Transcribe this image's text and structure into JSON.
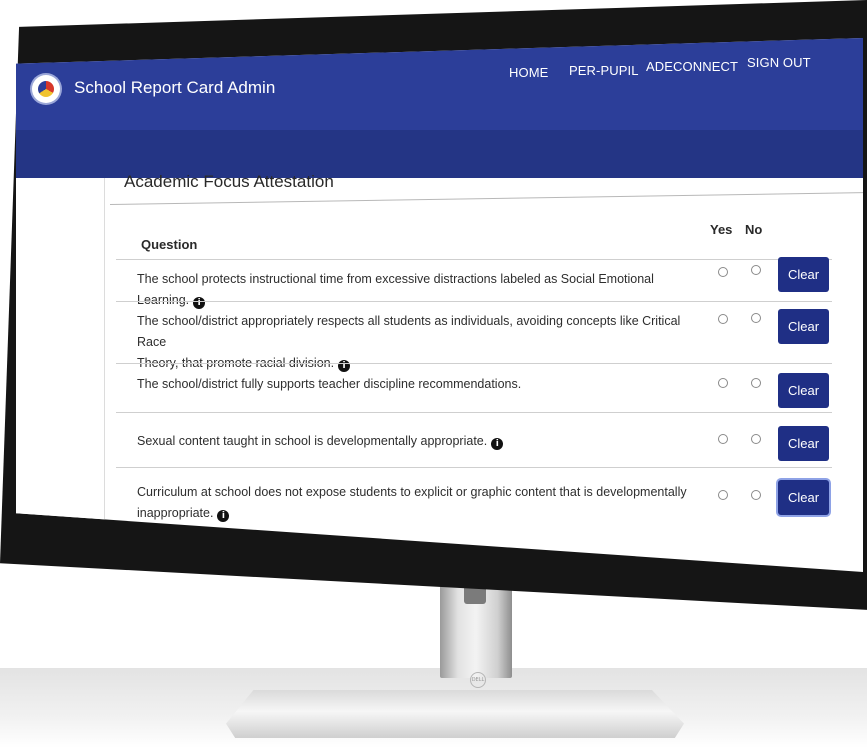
{
  "header": {
    "app_title": "School Report Card Admin",
    "nav": [
      "HOME",
      "PER-PUPIL",
      "ADECONNECT",
      "SIGN OUT"
    ]
  },
  "section": {
    "title": "Academic Focus Attestation"
  },
  "table": {
    "question_header": "Question",
    "yes_header": "Yes",
    "no_header": "No",
    "clear_label": "Clear",
    "rows": [
      {
        "line1": "The school protects instructional time from excessive distractions labeled as Social Emotional Learning.",
        "line2": "",
        "yes": false,
        "no": false
      },
      {
        "line1": "The school/district appropriately respects all students as individuals, avoiding concepts like Critical Race",
        "line2": "Theory, that promote racial division.",
        "yes": false,
        "no": false
      },
      {
        "line1": "The school/district fully supports teacher discipline recommendations.",
        "line2": "",
        "yes": false,
        "no": false
      },
      {
        "line1": "Sexual content taught in school is developmentally appropriate.",
        "line2": "",
        "yes": false,
        "no": false
      },
      {
        "line1": "Curriculum at school does not expose students to explicit or graphic content that is developmentally",
        "line2": "inappropriate.",
        "yes": false,
        "no": false
      }
    ]
  },
  "stand": {
    "logo_text": "DELL"
  },
  "colors": {
    "nav_blue": "#2c3e99",
    "subbar_blue": "#243585",
    "button_blue": "#1f2f85",
    "bezel": "#151515"
  }
}
